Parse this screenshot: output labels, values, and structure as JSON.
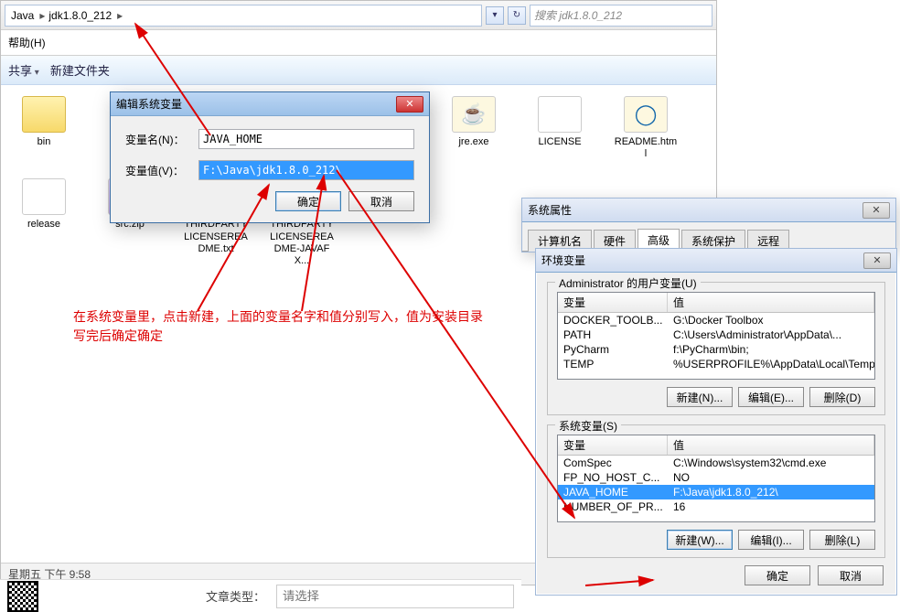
{
  "explorer": {
    "crumb1": "Java",
    "crumb2": "jdk1.8.0_212",
    "search_placeholder": "搜索 jdk1.8.0_212",
    "menu_help": "帮助(H)",
    "tb_share": "共享",
    "tb_newfolder": "新建文件夹",
    "files": {
      "bin": "bin",
      "src": "src.zip",
      "third1": "THIRDPARTYLICENSEREADME.txt",
      "third2": "THIRDPARTYLICENSEREADME-JAVAFX...",
      "jre": "jre.exe",
      "license": "LICENSE",
      "readme": "README.html",
      "release": "release"
    },
    "status": "星期五 下午 9:58"
  },
  "editdlg": {
    "title": "编辑系统变量",
    "name_label": "变量名(N)：",
    "name_value": "JAVA_HOME",
    "value_label": "变量值(V)：",
    "value_value": "F:\\Java\\jdk1.8.0_212\\",
    "ok": "确定",
    "cancel": "取消"
  },
  "sysprop": {
    "title": "系统属性",
    "tabs": {
      "t1": "计算机名",
      "t2": "硬件",
      "t3": "高级",
      "t4": "系统保护",
      "t5": "远程"
    }
  },
  "envdlg": {
    "title": "环境变量",
    "user_legend": "Administrator 的用户变量(U)",
    "sys_legend": "系统变量(S)",
    "col1": "变量",
    "col2": "值",
    "user_rows": [
      {
        "n": "DOCKER_TOOLB...",
        "v": "G:\\Docker Toolbox"
      },
      {
        "n": "PATH",
        "v": "C:\\Users\\Administrator\\AppData\\..."
      },
      {
        "n": "PyCharm",
        "v": "f:\\PyCharm\\bin;"
      },
      {
        "n": "TEMP",
        "v": "%USERPROFILE%\\AppData\\Local\\Temp"
      }
    ],
    "sys_rows": [
      {
        "n": "ComSpec",
        "v": "C:\\Windows\\system32\\cmd.exe"
      },
      {
        "n": "FP_NO_HOST_C...",
        "v": "NO"
      },
      {
        "n": "JAVA_HOME",
        "v": "F:\\Java\\jdk1.8.0_212\\"
      },
      {
        "n": "NUMBER_OF_PR...",
        "v": "16"
      }
    ],
    "btn_new_u": "新建(N)...",
    "btn_edit_u": "编辑(E)...",
    "btn_del_u": "删除(D)",
    "btn_new_s": "新建(W)...",
    "btn_edit_s": "编辑(I)...",
    "btn_del_s": "删除(L)",
    "ok": "确定",
    "cancel": "取消"
  },
  "annotation": "在系统变量里，点击新建，上面的变量名字和值分别写入，值为安装目录\n写完后确定确定",
  "bottom": {
    "label": "文章类型：",
    "placeholder": "请选择"
  }
}
